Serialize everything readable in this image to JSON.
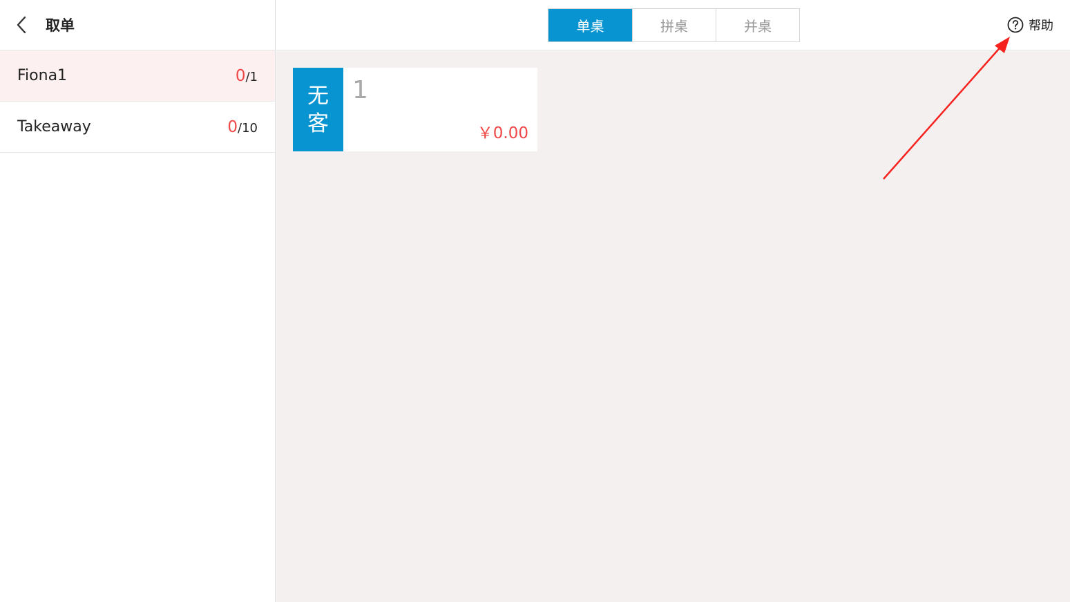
{
  "sidebar": {
    "title": "取单",
    "areas": [
      {
        "name": "Fiona1",
        "count": "0",
        "total": "/1"
      },
      {
        "name": "Takeaway",
        "count": "0",
        "total": "/10"
      }
    ]
  },
  "topbar": {
    "tabs": [
      {
        "label": "单桌"
      },
      {
        "label": "拼桌"
      },
      {
        "label": "并桌"
      }
    ],
    "help_label": "帮助"
  },
  "tables": [
    {
      "status_line1": "无",
      "status_line2": "客",
      "number": "1",
      "amount": "￥0.00"
    }
  ],
  "colors": {
    "accent": "#0894d0",
    "highlight_red": "#f04848",
    "active_row_bg": "#fdf0f0",
    "main_bg": "#f4f0ef",
    "annotation_arrow": "#f5221e"
  },
  "icons": {
    "back": "chevron-left-icon",
    "help": "question-circle-icon"
  }
}
